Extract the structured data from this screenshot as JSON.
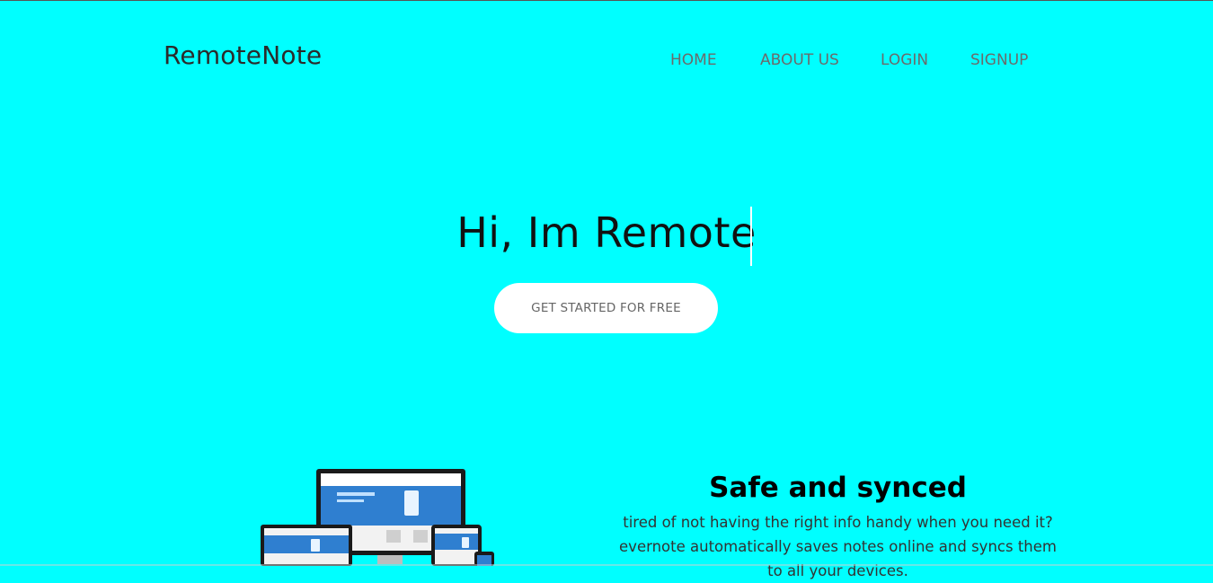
{
  "header": {
    "brand": "RemoteNote",
    "nav": [
      {
        "label": "HOME"
      },
      {
        "label": "ABOUT US"
      },
      {
        "label": "LOGIN"
      },
      {
        "label": "SIGNUP"
      }
    ]
  },
  "hero": {
    "title": "Hi, Im Remote",
    "cta_label": "GET STARTED FOR FREE"
  },
  "feature": {
    "title": "Safe and synced",
    "text": "tired of not having the right info handy when you need it? evernote automatically saves notes online and syncs them to all your devices."
  },
  "colors": {
    "background": "#00ffff",
    "button_bg": "#ffffff",
    "nav_text": "#6b6b6b"
  },
  "image": {
    "name": "responsive-devices-illustration"
  }
}
